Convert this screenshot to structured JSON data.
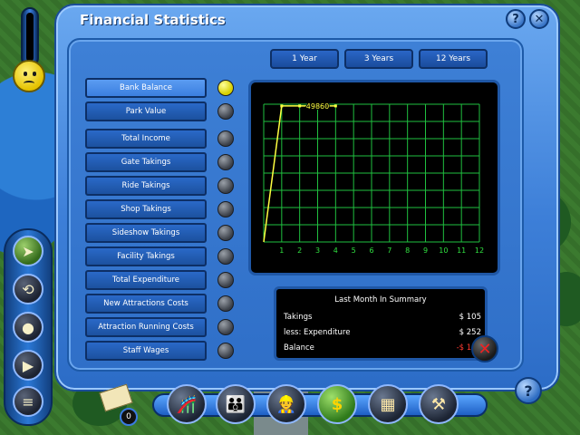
{
  "window": {
    "title": "Financial Statistics",
    "help_glyph": "?",
    "close_glyph": "✕"
  },
  "period_tabs": [
    {
      "label": "1 Year",
      "active": true
    },
    {
      "label": "3 Years",
      "active": false
    },
    {
      "label": "12 Years",
      "active": false
    }
  ],
  "stats": [
    {
      "label": "Bank Balance",
      "active": true
    },
    {
      "label": "Park Value",
      "active": false
    },
    {
      "label": "Total Income",
      "active": false
    },
    {
      "label": "Gate Takings",
      "active": false
    },
    {
      "label": "Ride Takings",
      "active": false
    },
    {
      "label": "Shop Takings",
      "active": false
    },
    {
      "label": "Sideshow Takings",
      "active": false
    },
    {
      "label": "Facility Takings",
      "active": false
    },
    {
      "label": "Total Expenditure",
      "active": false
    },
    {
      "label": "New Attractions Costs",
      "active": false
    },
    {
      "label": "Attraction Running Costs",
      "active": false
    },
    {
      "label": "Staff Wages",
      "active": false
    }
  ],
  "chart_data": {
    "type": "line",
    "x_ticks": [
      "1",
      "2",
      "3",
      "4",
      "5",
      "6",
      "7",
      "8",
      "9",
      "10",
      "11",
      "12"
    ],
    "series": [
      {
        "values": [
          [
            0,
            0
          ],
          [
            1,
            49860
          ],
          [
            2,
            49860
          ],
          [
            3,
            49860
          ],
          [
            4,
            49860
          ]
        ]
      }
    ],
    "data_label": {
      "x": 3,
      "text": "49860"
    },
    "xlim": [
      0,
      12
    ],
    "ylim": [
      0,
      50500
    ],
    "grid": true,
    "colors": {
      "line": "#ffff40",
      "grid": "#20c040",
      "tick": "#30e040"
    }
  },
  "summary": {
    "title": "Last Month In Summary",
    "rows": [
      {
        "label": "Takings",
        "value": "$ 105",
        "negative": false
      },
      {
        "label": "less: Expenditure",
        "value": "$ 252",
        "negative": false
      },
      {
        "label": "Balance",
        "value": "-$ 147",
        "negative": true
      }
    ]
  },
  "mail": {
    "count": "0"
  },
  "bottom_toolbar": [
    {
      "icon": "rides-icon",
      "glyph": "🎢",
      "active": false
    },
    {
      "icon": "guests-icon",
      "glyph": "👪",
      "active": false
    },
    {
      "icon": "staff-icon",
      "glyph": "👷",
      "active": false
    },
    {
      "icon": "finance-icon",
      "glyph": "$",
      "active": true
    },
    {
      "icon": "cage-icon",
      "glyph": "▦",
      "active": false
    },
    {
      "icon": "tools-icon",
      "glyph": "⚒",
      "active": false
    }
  ],
  "left_tools": [
    {
      "icon": "pointer-icon",
      "glyph": "➤",
      "active": true
    },
    {
      "icon": "camera-rotate-icon",
      "glyph": "⟲",
      "active": false
    },
    {
      "icon": "bomb-icon",
      "glyph": "●",
      "active": false
    },
    {
      "icon": "video-camera-icon",
      "glyph": "▶",
      "active": false
    },
    {
      "icon": "notepad-icon",
      "glyph": "≡",
      "active": false
    }
  ],
  "colors": {
    "accent": "#3b7fe0",
    "negative": "#ff3b30",
    "chart_bg": "#000000"
  }
}
